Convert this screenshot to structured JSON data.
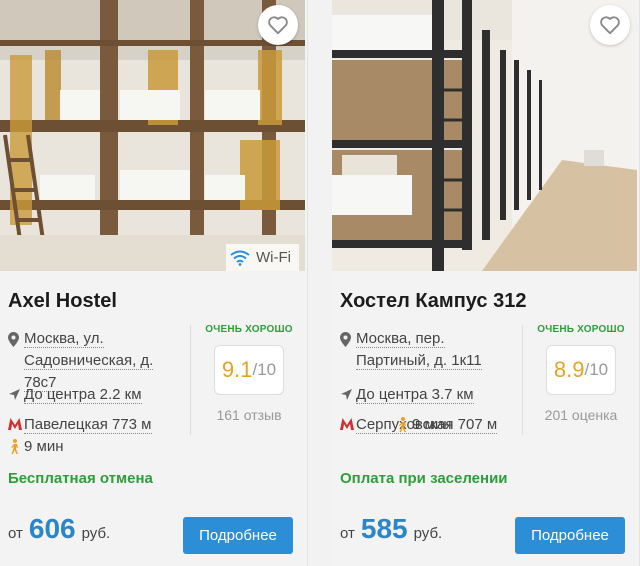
{
  "cards": [
    {
      "name": "Axel Hostel",
      "address": "Москва, ул. Садовническая, д. 78с7",
      "distance": "До центра 2.2 км",
      "metro": "Павелецкая 773 м",
      "walk_time": "9 мин",
      "rating_label": "ОЧЕНЬ ХОРОШО",
      "score": "9.1",
      "score_max": "/10",
      "reviews": "161 отзыв",
      "feature": "Бесплатная отмена",
      "badge": "Wi-Fi",
      "price_prefix": "от",
      "price": "606",
      "currency": "руб.",
      "button": "Подробнее"
    },
    {
      "name": "Хостел Кампус 312",
      "address": "Москва, пер. Партиный, д. 1к11",
      "distance": "До центра 3.7 км",
      "metro": "Серпуховская 707 м",
      "walk_time": "9 мин",
      "rating_label": "ОЧЕНЬ ХОРОШО",
      "score": "8.9",
      "score_max": "/10",
      "reviews": "201 оценка",
      "feature": "Оплата при заселении",
      "price_prefix": "от",
      "price": "585",
      "currency": "руб.",
      "button": "Подробнее"
    }
  ],
  "colors": {
    "accent_blue": "#2d8ed8",
    "price_blue": "#2a85c9",
    "green": "#2e9e3b",
    "score_orange": "#e5a422",
    "metro_red": "#d32f2f",
    "walk_orange": "#f0a020"
  },
  "icons": {
    "favorite": "heart-outline-icon",
    "location": "map-pin-icon",
    "distance": "navigation-arrow-icon",
    "metro": "metro-m-icon",
    "walk": "walking-person-icon",
    "wifi": "wifi-icon"
  }
}
